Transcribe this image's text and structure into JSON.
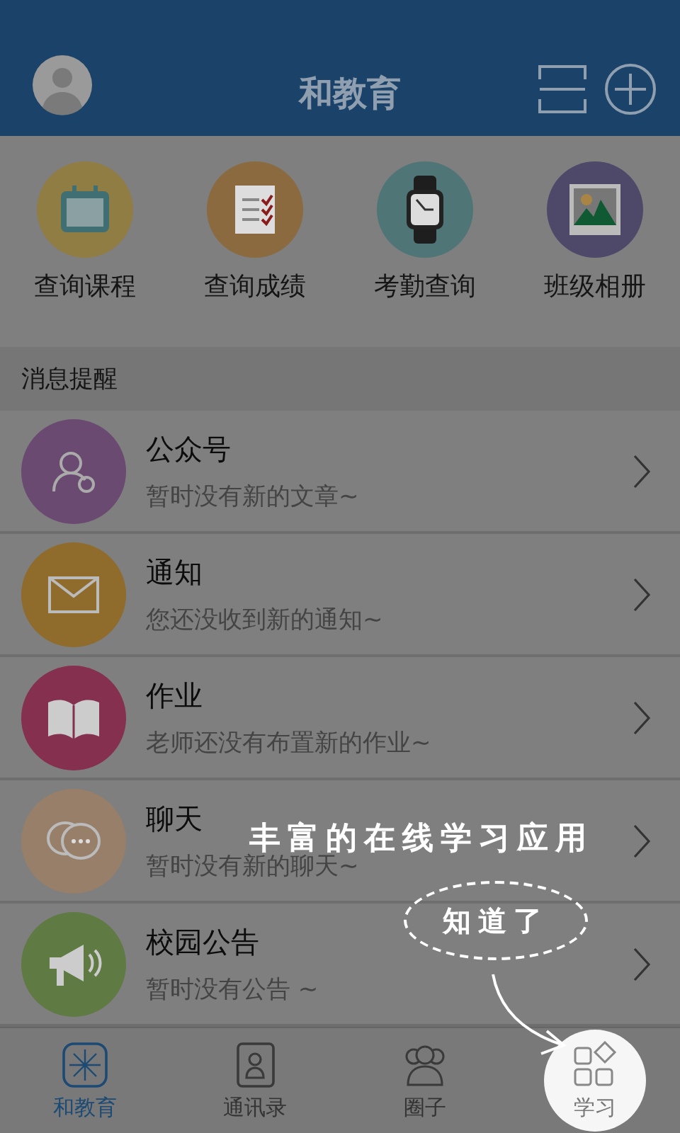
{
  "header": {
    "title": "和教育"
  },
  "shortcuts": [
    {
      "kind": "calendar",
      "label": "查询课程"
    },
    {
      "kind": "checklist",
      "label": "查询成绩"
    },
    {
      "kind": "watch",
      "label": "考勤查询"
    },
    {
      "kind": "album",
      "label": "班级相册"
    }
  ],
  "section": {
    "title": "消息提醒"
  },
  "messages": [
    {
      "kind": "account",
      "title": "公众号",
      "subtitle": "暂时没有新的文章~"
    },
    {
      "kind": "mail",
      "title": "通知",
      "subtitle": "您还没收到新的通知~"
    },
    {
      "kind": "book",
      "title": "作业",
      "subtitle": "老师还没有布置新的作业~"
    },
    {
      "kind": "chat",
      "title": "聊天",
      "subtitle": "暂时没有新的聊天~"
    },
    {
      "kind": "megaphone",
      "title": "校园公告",
      "subtitle": "暂时没有公告 ~"
    }
  ],
  "tabs": [
    {
      "kind": "home",
      "label": "和教育",
      "selected": true,
      "spotlight": false
    },
    {
      "kind": "contacts",
      "label": "通讯录",
      "selected": false,
      "spotlight": false
    },
    {
      "kind": "people",
      "label": "圈子",
      "selected": false,
      "spotlight": false
    },
    {
      "kind": "apps",
      "label": "学习",
      "selected": false,
      "spotlight": true
    }
  ],
  "coach": {
    "tip": "丰富的在线学习应用",
    "dismiss": "知道了"
  }
}
